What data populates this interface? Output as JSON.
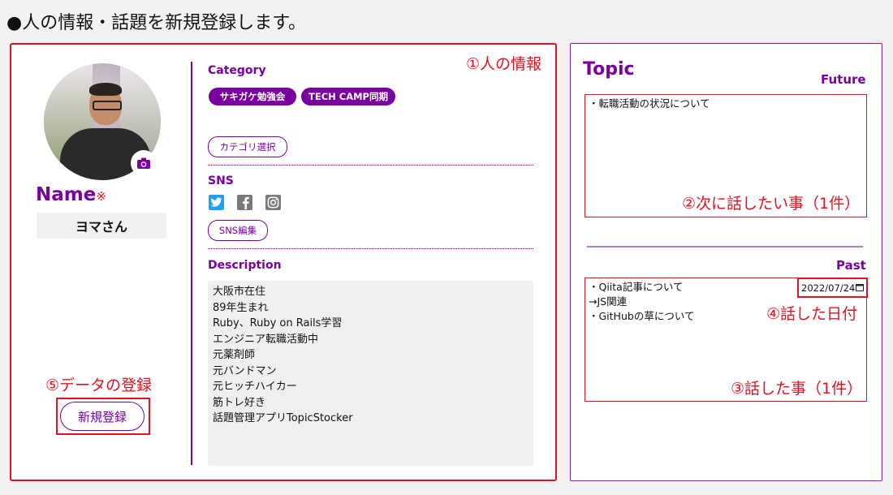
{
  "page": {
    "heading": "●人の情報・話題を新規登録します。"
  },
  "profile": {
    "name_label": "Name",
    "required_mark": "※",
    "name_value": "ヨマさん",
    "register_button": "新規登録",
    "annotation_section": "①人の情報",
    "annotation_register": "⑤データの登録"
  },
  "category": {
    "title": "Category",
    "chips": [
      "サキガケ勉強会",
      "TECH CAMP同期"
    ],
    "select_button": "カテゴリ選択"
  },
  "sns": {
    "title": "SNS",
    "icons": [
      "twitter-icon",
      "facebook-icon",
      "instagram-icon"
    ],
    "edit_button": "SNS編集"
  },
  "description": {
    "title": "Description",
    "lines": [
      "大阪市在住",
      "89年生まれ",
      "Ruby、Ruby on Rails学習",
      "エンジニア転職活動中",
      "元薬剤師",
      "元バンドマン",
      "元ヒッチハイカー",
      "筋トレ好き",
      "話題管理アプリTopicStocker"
    ]
  },
  "topic": {
    "title": "Topic",
    "future_label": "Future",
    "future_lines": [
      "・転職活動の状況について"
    ],
    "future_annotation": "②次に話したい事（1件）",
    "past_label": "Past",
    "past_lines": [
      "・Qiita記事について",
      "→JS関連",
      "・GitHubの草について"
    ],
    "past_date": "2022/07/24",
    "date_annotation": "④話した日付",
    "past_annotation": "③話した事（1件）"
  },
  "colors": {
    "accent": "#7a00a0",
    "annotation": "#e8101f"
  }
}
